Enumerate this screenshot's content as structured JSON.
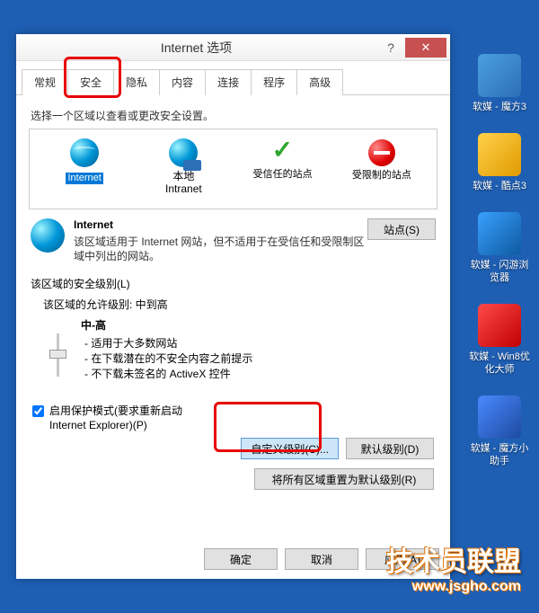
{
  "dialog": {
    "title": "Internet 选项",
    "tabs": [
      "常规",
      "安全",
      "隐私",
      "内容",
      "连接",
      "程序",
      "高级"
    ],
    "active_tab": 1,
    "section_label": "选择一个区域以查看或更改安全设置。",
    "zones": [
      {
        "label": "Internet",
        "selected": true
      },
      {
        "label": "本地\nIntranet"
      },
      {
        "label": "受信任的站点"
      },
      {
        "label": "受限制的站点"
      }
    ],
    "info": {
      "title": "Internet",
      "desc": "该区域适用于 Internet 网站，但不适用于在受信任和受限制区域中列出的网站。",
      "sites_btn": "站点(S)"
    },
    "level": {
      "heading": "该区域的安全级别(L)",
      "allowed": "该区域的允许级别: 中到高",
      "name": "中-高",
      "bullets": [
        "- 适用于大多数网站",
        "- 在下载潜在的不安全内容之前提示",
        "- 不下载未签名的 ActiveX 控件"
      ]
    },
    "protect": {
      "checked": true,
      "label": "启用保护模式(要求重新启动 Internet Explorer)(P)"
    },
    "custom_btn": "自定义级别(C)...",
    "default_btn": "默认级别(D)",
    "reset_btn": "将所有区域重置为默认级别(R)",
    "ok": "确定",
    "cancel": "取消",
    "apply": "应用(A)"
  },
  "desktop": [
    {
      "label": "软媒 - 魔方3",
      "cls": "di-cube"
    },
    {
      "label": "软媒 - 酷点3",
      "cls": "di-cool"
    },
    {
      "label": "软媒 - 闪游浏览器",
      "cls": "di-flash"
    },
    {
      "label": "软媒 - Win8优化大师",
      "cls": "di-w8"
    },
    {
      "label": "软媒 - 魔方小助手",
      "cls": "di-help"
    }
  ],
  "watermark": {
    "line1": "技术员联盟",
    "line2": "www.jsgho.com"
  }
}
